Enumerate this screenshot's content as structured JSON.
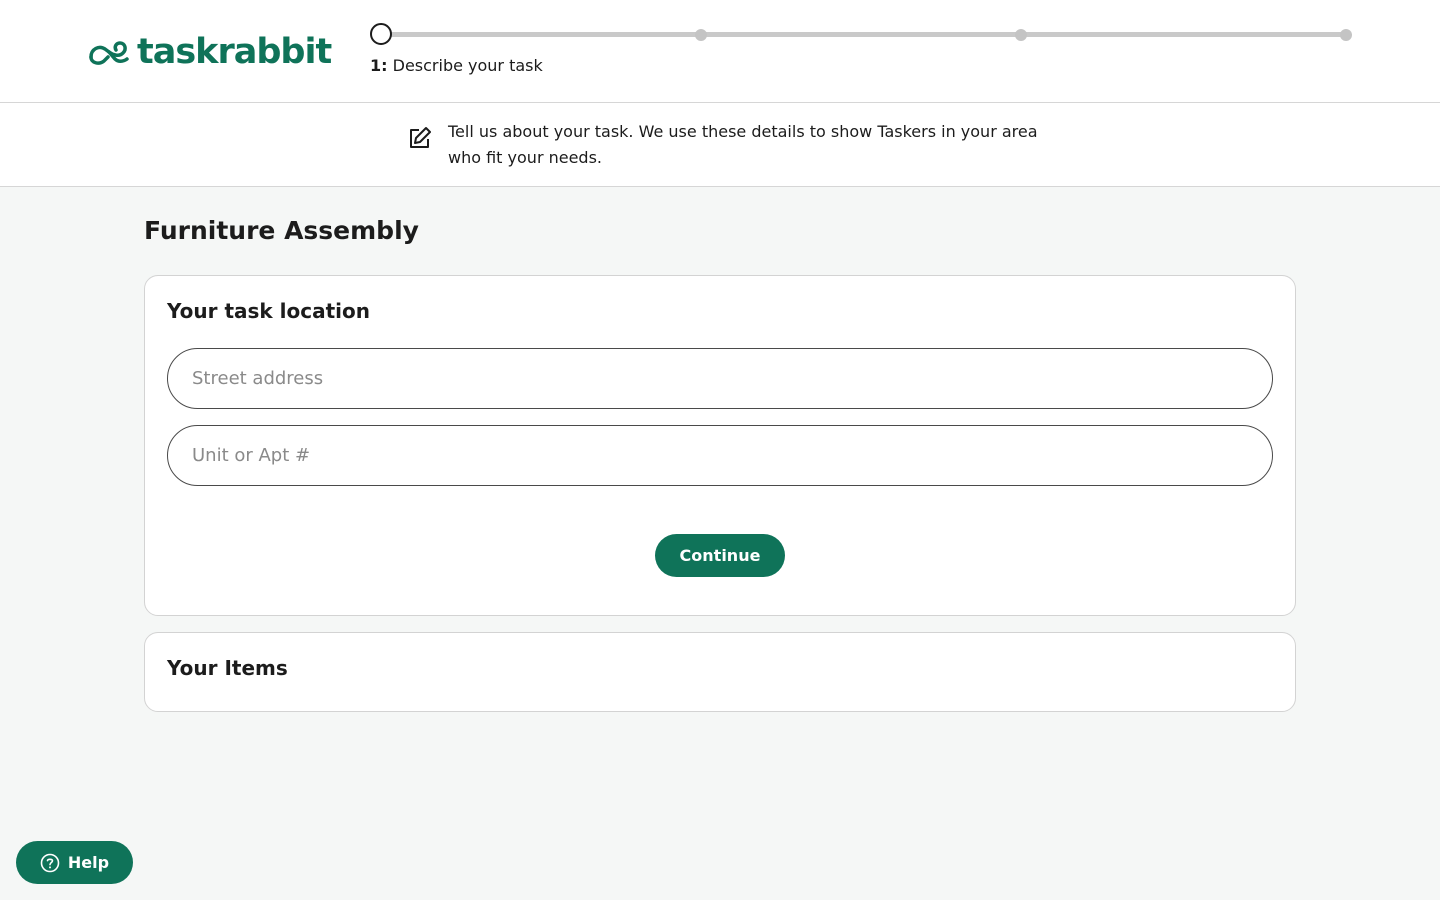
{
  "brand": {
    "name": "taskrabbit",
    "color": "#0f7359",
    "icon": "rabbit-logo-icon"
  },
  "progress": {
    "current_step": 1,
    "total_steps": 4,
    "step_number": "1:",
    "step_label": "Describe your task"
  },
  "info": {
    "icon": "edit-icon",
    "text": "Tell us about your task. We use these details to show Taskers in your area who fit your needs."
  },
  "main": {
    "title": "Furniture Assembly",
    "location_card": {
      "title": "Your task location",
      "street": {
        "value": "",
        "placeholder": "Street address"
      },
      "unit": {
        "value": "",
        "placeholder": "Unit or Apt #"
      },
      "continue_label": "Continue"
    },
    "items_card": {
      "title": "Your Items"
    }
  },
  "help": {
    "label": "Help",
    "icon": "question-circle-icon"
  }
}
